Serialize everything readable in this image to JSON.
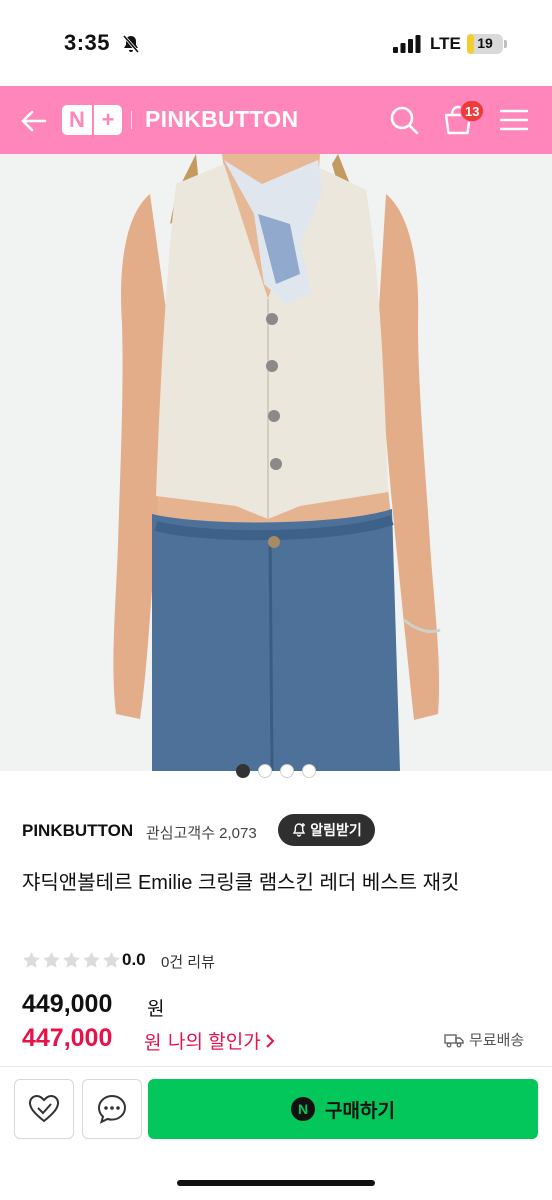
{
  "status_bar": {
    "time": "3:35",
    "network": "LTE",
    "battery": "19",
    "battery_level": 0.19
  },
  "header": {
    "logo": "N+",
    "brand": "PINKBUTTON",
    "cart_count": "13",
    "accent_color": "#ff86ba"
  },
  "product_image": {
    "alt": "",
    "dots": 4,
    "active_dot": 0
  },
  "seller": {
    "name": "PINKBUTTON",
    "watchers": "관심고객수 2,073",
    "alert_label": "알림받기"
  },
  "product": {
    "title": "쟈딕앤볼테르 Emilie 크링클 램스킨 레더 베스트 재킷",
    "rating_score": "0.0",
    "rating_value": 0,
    "review_count": "0건 리뷰",
    "price_original": "449,000",
    "price_original_unit": "원",
    "price_sale": "447,000",
    "price_sale_unit": "원",
    "my_discount_label": "나의 할인가",
    "shipping": "무료배송",
    "sale_color": "#e8114a"
  },
  "bottom_bar": {
    "buy_label": "구매하기",
    "buy_color": "#03c75a",
    "icons": [
      "heart-check-icon",
      "chat-icon"
    ]
  }
}
